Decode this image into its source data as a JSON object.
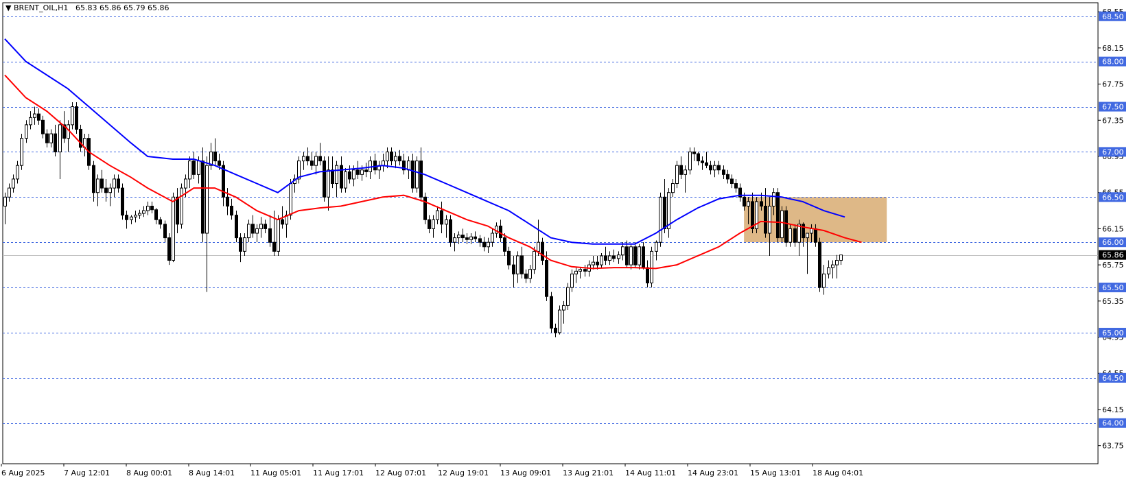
{
  "chart_data": {
    "type": "candlestick",
    "title": "BRENT_OIL,H1",
    "ohlc_header": "65.83 65.86 65.79 65.86",
    "current_price": 65.86,
    "ylim": [
      63.55,
      68.65
    ],
    "y_ticks": [
      "68.55",
      "68.15",
      "67.75",
      "67.35",
      "66.95",
      "66.55",
      "66.15",
      "65.75",
      "65.35",
      "64.95",
      "64.55",
      "64.15",
      "63.75"
    ],
    "levels": [
      "68.50",
      "68.00",
      "67.50",
      "67.00",
      "66.50",
      "66.00",
      "65.50",
      "65.00",
      "64.50",
      "64.00"
    ],
    "x_labels": [
      "6 Aug 2025",
      "7 Aug 12:01",
      "8 Aug 00:01",
      "8 Aug 14:01",
      "11 Aug 05:01",
      "11 Aug 17:01",
      "12 Aug 07:01",
      "12 Aug 19:01",
      "13 Aug 09:01",
      "13 Aug 21:01",
      "14 Aug 11:01",
      "14 Aug 23:01",
      "15 Aug 13:01",
      "18 Aug 04:01"
    ],
    "zone": {
      "from_bar": 176,
      "to_bar": 210,
      "low": 66.0,
      "high": 66.5,
      "color": "#deb887"
    },
    "colors": {
      "grid": "#4169e1",
      "ma_fast": "#ff0000",
      "ma_slow": "#0000ff",
      "zone": "#deb887"
    },
    "candles": [
      [
        66.4,
        66.55,
        66.2,
        66.5
      ],
      [
        66.5,
        66.65,
        66.45,
        66.6
      ],
      [
        66.6,
        66.75,
        66.55,
        66.7
      ],
      [
        66.7,
        66.9,
        66.65,
        66.85
      ],
      [
        66.85,
        67.2,
        66.8,
        67.15
      ],
      [
        67.15,
        67.35,
        67.1,
        67.3
      ],
      [
        67.3,
        67.45,
        67.25,
        67.38
      ],
      [
        67.38,
        67.5,
        67.3,
        67.42
      ],
      [
        67.42,
        67.48,
        67.3,
        67.35
      ],
      [
        67.35,
        67.4,
        67.15,
        67.2
      ],
      [
        67.2,
        67.25,
        67.05,
        67.1
      ],
      [
        67.1,
        67.25,
        67.05,
        67.2
      ],
      [
        67.2,
        67.3,
        66.95,
        67.0
      ],
      [
        67.0,
        67.35,
        66.7,
        67.3
      ],
      [
        67.3,
        67.45,
        67.1,
        67.15
      ],
      [
        67.15,
        67.35,
        67.0,
        67.3
      ],
      [
        67.3,
        67.55,
        67.25,
        67.5
      ],
      [
        67.5,
        67.55,
        67.2,
        67.25
      ],
      [
        67.25,
        67.3,
        67.0,
        67.05
      ],
      [
        67.05,
        67.2,
        66.95,
        67.15
      ],
      [
        67.15,
        67.2,
        66.8,
        66.85
      ],
      [
        66.85,
        66.9,
        66.45,
        66.55
      ],
      [
        66.55,
        66.75,
        66.4,
        66.7
      ],
      [
        66.7,
        66.8,
        66.55,
        66.6
      ],
      [
        66.6,
        66.7,
        66.45,
        66.55
      ],
      [
        66.55,
        66.65,
        66.4,
        66.6
      ],
      [
        66.6,
        66.75,
        66.5,
        66.7
      ],
      [
        66.7,
        66.75,
        66.55,
        66.6
      ],
      [
        66.6,
        66.65,
        66.25,
        66.3
      ],
      [
        66.3,
        66.35,
        66.15,
        66.25
      ],
      [
        66.25,
        66.3,
        66.2,
        66.28
      ],
      [
        66.28,
        66.35,
        66.22,
        66.3
      ],
      [
        66.3,
        66.36,
        66.26,
        66.32
      ],
      [
        66.32,
        66.4,
        66.28,
        66.35
      ],
      [
        66.35,
        66.45,
        66.3,
        66.4
      ],
      [
        66.4,
        66.45,
        66.32,
        66.36
      ],
      [
        66.36,
        66.38,
        66.2,
        66.25
      ],
      [
        66.25,
        66.28,
        66.15,
        66.2
      ],
      [
        66.2,
        66.24,
        66.0,
        66.05
      ],
      [
        66.05,
        66.1,
        65.75,
        65.8
      ],
      [
        65.8,
        66.55,
        65.78,
        66.5
      ],
      [
        66.5,
        66.6,
        66.1,
        66.2
      ],
      [
        66.2,
        66.65,
        66.15,
        66.6
      ],
      [
        66.6,
        66.75,
        66.5,
        66.7
      ],
      [
        66.7,
        66.95,
        66.6,
        66.9
      ],
      [
        66.9,
        67.0,
        66.7,
        66.75
      ],
      [
        66.75,
        66.95,
        66.65,
        66.9
      ],
      [
        66.9,
        67.05,
        66.0,
        66.1
      ],
      [
        66.1,
        66.95,
        65.45,
        66.85
      ],
      [
        66.85,
        67.1,
        66.8,
        67.0
      ],
      [
        67.0,
        67.15,
        66.85,
        66.9
      ],
      [
        66.9,
        66.98,
        66.8,
        66.85
      ],
      [
        66.85,
        66.9,
        66.4,
        66.5
      ],
      [
        66.5,
        66.6,
        66.3,
        66.4
      ],
      [
        66.4,
        66.48,
        66.25,
        66.3
      ],
      [
        66.3,
        66.35,
        66.0,
        66.05
      ],
      [
        66.05,
        66.1,
        65.78,
        65.9
      ],
      [
        65.9,
        66.1,
        65.85,
        66.05
      ],
      [
        66.05,
        66.25,
        66.0,
        66.2
      ],
      [
        66.2,
        66.3,
        66.05,
        66.1
      ],
      [
        66.1,
        66.2,
        66.0,
        66.15
      ],
      [
        66.15,
        66.28,
        66.05,
        66.2
      ],
      [
        66.2,
        66.25,
        66.1,
        66.15
      ],
      [
        66.15,
        66.3,
        65.95,
        66.0
      ],
      [
        66.0,
        66.35,
        65.85,
        65.9
      ],
      [
        65.9,
        66.3,
        65.85,
        66.25
      ],
      [
        66.25,
        66.4,
        66.15,
        66.2
      ],
      [
        66.2,
        66.35,
        66.05,
        66.3
      ],
      [
        66.3,
        66.7,
        66.25,
        66.65
      ],
      [
        66.65,
        66.75,
        66.55,
        66.7
      ],
      [
        66.7,
        66.95,
        66.65,
        66.9
      ],
      [
        66.9,
        67.0,
        66.8,
        66.95
      ],
      [
        66.95,
        67.05,
        66.85,
        66.9
      ],
      [
        66.9,
        67.0,
        66.8,
        66.85
      ],
      [
        66.85,
        67.0,
        66.75,
        66.95
      ],
      [
        66.95,
        67.1,
        66.85,
        66.9
      ],
      [
        66.9,
        66.95,
        66.45,
        66.5
      ],
      [
        66.5,
        66.95,
        66.35,
        66.8
      ],
      [
        66.8,
        66.95,
        66.6,
        66.65
      ],
      [
        66.65,
        66.9,
        66.5,
        66.85
      ],
      [
        66.85,
        66.95,
        66.55,
        66.6
      ],
      [
        66.6,
        66.82,
        66.55,
        66.78
      ],
      [
        66.78,
        66.85,
        66.65,
        66.7
      ],
      [
        66.7,
        66.85,
        66.62,
        66.8
      ],
      [
        66.8,
        66.9,
        66.7,
        66.75
      ],
      [
        66.75,
        66.85,
        66.68,
        66.8
      ],
      [
        66.8,
        66.88,
        66.72,
        66.78
      ],
      [
        66.78,
        66.95,
        66.7,
        66.9
      ],
      [
        66.9,
        66.98,
        66.75,
        66.8
      ],
      [
        66.8,
        66.9,
        66.7,
        66.85
      ],
      [
        66.85,
        66.98,
        66.78,
        66.9
      ],
      [
        66.9,
        67.05,
        66.82,
        67.0
      ],
      [
        67.0,
        67.05,
        66.85,
        66.9
      ],
      [
        66.9,
        67.0,
        66.82,
        66.95
      ],
      [
        66.95,
        67.02,
        66.85,
        66.9
      ],
      [
        66.9,
        66.98,
        66.75,
        66.8
      ],
      [
        66.8,
        66.95,
        66.7,
        66.9
      ],
      [
        66.9,
        66.98,
        66.55,
        66.6
      ],
      [
        66.6,
        66.95,
        66.55,
        66.9
      ],
      [
        66.9,
        67.05,
        66.45,
        66.5
      ],
      [
        66.5,
        66.55,
        66.2,
        66.25
      ],
      [
        66.25,
        66.3,
        66.1,
        66.15
      ],
      [
        66.15,
        66.3,
        66.05,
        66.25
      ],
      [
        66.25,
        66.4,
        66.2,
        66.35
      ],
      [
        66.35,
        66.45,
        66.1,
        66.2
      ],
      [
        66.2,
        66.3,
        66.05,
        66.25
      ],
      [
        66.25,
        66.3,
        65.95,
        66.0
      ],
      [
        66.0,
        66.1,
        65.9,
        66.05
      ],
      [
        66.05,
        66.12,
        65.98,
        66.08
      ],
      [
        66.08,
        66.15,
        66.0,
        66.05
      ],
      [
        66.05,
        66.1,
        65.98,
        66.03
      ],
      [
        66.03,
        66.1,
        65.98,
        66.06
      ],
      [
        66.06,
        66.12,
        66.0,
        66.04
      ],
      [
        66.04,
        66.08,
        65.95,
        66.0
      ],
      [
        66.0,
        66.06,
        65.9,
        65.95
      ],
      [
        65.95,
        66.05,
        65.88,
        66.0
      ],
      [
        66.0,
        66.15,
        65.95,
        66.1
      ],
      [
        66.1,
        66.22,
        66.05,
        66.18
      ],
      [
        66.18,
        66.25,
        66.0,
        66.05
      ],
      [
        66.05,
        66.1,
        65.85,
        65.9
      ],
      [
        65.9,
        65.95,
        65.7,
        65.75
      ],
      [
        65.75,
        65.85,
        65.5,
        65.65
      ],
      [
        65.65,
        65.9,
        65.55,
        65.85
      ],
      [
        65.85,
        65.95,
        65.6,
        65.65
      ],
      [
        65.65,
        65.7,
        65.55,
        65.6
      ],
      [
        65.6,
        65.75,
        65.55,
        65.7
      ],
      [
        65.7,
        65.95,
        65.65,
        65.9
      ],
      [
        65.9,
        66.25,
        65.85,
        66.0
      ],
      [
        66.0,
        66.05,
        65.75,
        65.8
      ],
      [
        65.8,
        65.9,
        65.35,
        65.4
      ],
      [
        65.4,
        65.45,
        65.0,
        65.05
      ],
      [
        65.05,
        65.1,
        64.95,
        65.0
      ],
      [
        65.0,
        65.3,
        64.98,
        65.25
      ],
      [
        65.25,
        65.35,
        65.1,
        65.3
      ],
      [
        65.3,
        65.55,
        65.25,
        65.5
      ],
      [
        65.5,
        65.7,
        65.45,
        65.65
      ],
      [
        65.65,
        65.72,
        65.55,
        65.68
      ],
      [
        65.68,
        65.72,
        65.6,
        65.7
      ],
      [
        65.7,
        65.75,
        65.62,
        65.68
      ],
      [
        65.68,
        65.8,
        65.62,
        65.75
      ],
      [
        65.75,
        65.85,
        65.7,
        65.78
      ],
      [
        65.78,
        65.85,
        65.7,
        65.75
      ],
      [
        65.75,
        65.88,
        65.72,
        65.85
      ],
      [
        65.85,
        65.95,
        65.75,
        65.8
      ],
      [
        65.8,
        65.9,
        65.75,
        65.85
      ],
      [
        65.85,
        65.92,
        65.78,
        65.82
      ],
      [
        65.82,
        65.9,
        65.76,
        65.86
      ],
      [
        65.86,
        66.0,
        65.8,
        65.95
      ],
      [
        65.95,
        66.02,
        65.72,
        65.75
      ],
      [
        65.75,
        65.98,
        65.7,
        65.95
      ],
      [
        65.95,
        66.0,
        65.72,
        65.75
      ],
      [
        65.75,
        65.98,
        65.7,
        65.95
      ],
      [
        65.95,
        66.0,
        65.7,
        65.72
      ],
      [
        65.72,
        65.8,
        65.5,
        65.55
      ],
      [
        65.55,
        65.95,
        65.5,
        65.9
      ],
      [
        65.9,
        66.02,
        65.8,
        66.0
      ],
      [
        66.0,
        66.55,
        65.95,
        66.5
      ],
      [
        66.5,
        66.7,
        66.1,
        66.15
      ],
      [
        66.15,
        66.6,
        66.05,
        66.55
      ],
      [
        66.55,
        66.7,
        66.5,
        66.65
      ],
      [
        66.65,
        66.9,
        66.6,
        66.85
      ],
      [
        66.85,
        66.95,
        66.7,
        66.75
      ],
      [
        66.75,
        66.85,
        66.55,
        66.8
      ],
      [
        66.8,
        67.05,
        66.75,
        67.0
      ],
      [
        67.0,
        67.05,
        66.9,
        66.98
      ],
      [
        66.98,
        67.0,
        66.85,
        66.9
      ],
      [
        66.9,
        66.95,
        66.8,
        66.88
      ],
      [
        66.88,
        67.0,
        66.82,
        66.85
      ],
      [
        66.85,
        66.9,
        66.75,
        66.8
      ],
      [
        66.8,
        66.9,
        66.72,
        66.85
      ],
      [
        66.85,
        66.9,
        66.75,
        66.8
      ],
      [
        66.8,
        66.85,
        66.7,
        66.75
      ],
      [
        66.75,
        66.8,
        66.65,
        66.7
      ],
      [
        66.7,
        66.75,
        66.6,
        66.65
      ],
      [
        66.65,
        66.7,
        66.55,
        66.6
      ],
      [
        66.6,
        66.65,
        66.45,
        66.5
      ],
      [
        66.5,
        66.55,
        66.35,
        66.4
      ],
      [
        66.4,
        66.5,
        66.2,
        66.45
      ],
      [
        66.45,
        66.55,
        66.1,
        66.15
      ],
      [
        66.15,
        66.5,
        66.1,
        66.45
      ],
      [
        66.45,
        66.55,
        66.35,
        66.4
      ],
      [
        66.4,
        66.6,
        66.05,
        66.1
      ],
      [
        66.1,
        66.5,
        65.85,
        66.4
      ],
      [
        66.4,
        66.6,
        66.3,
        66.55
      ],
      [
        66.55,
        66.6,
        66.0,
        66.05
      ],
      [
        66.05,
        66.4,
        66.0,
        66.35
      ],
      [
        66.35,
        66.4,
        65.95,
        66.0
      ],
      [
        66.0,
        66.2,
        65.95,
        66.15
      ],
      [
        66.15,
        66.2,
        65.95,
        66.0
      ],
      [
        66.0,
        66.25,
        65.85,
        66.2
      ],
      [
        66.2,
        66.22,
        65.95,
        66.05
      ],
      [
        66.05,
        66.1,
        65.65,
        66.1
      ],
      [
        66.1,
        66.2,
        66.0,
        66.15
      ],
      [
        66.15,
        66.2,
        65.95,
        66.0
      ],
      [
        66.0,
        66.05,
        65.45,
        65.5
      ],
      [
        65.5,
        65.75,
        65.42,
        65.65
      ],
      [
        65.65,
        65.8,
        65.6,
        65.72
      ],
      [
        65.72,
        65.8,
        65.6,
        65.75
      ],
      [
        65.75,
        65.86,
        65.6,
        65.8
      ],
      [
        65.8,
        65.86,
        65.75,
        65.86
      ]
    ],
    "ma_fast": [
      [
        0,
        67.85
      ],
      [
        5,
        67.6
      ],
      [
        10,
        67.45
      ],
      [
        15,
        67.25
      ],
      [
        20,
        67.0
      ],
      [
        25,
        66.85
      ],
      [
        30,
        66.72
      ],
      [
        34,
        66.6
      ],
      [
        40,
        66.45
      ],
      [
        45,
        66.6
      ],
      [
        50,
        66.6
      ],
      [
        55,
        66.5
      ],
      [
        60,
        66.35
      ],
      [
        65,
        66.25
      ],
      [
        70,
        66.35
      ],
      [
        75,
        66.38
      ],
      [
        80,
        66.4
      ],
      [
        85,
        66.45
      ],
      [
        90,
        66.5
      ],
      [
        95,
        66.52
      ],
      [
        100,
        66.45
      ],
      [
        105,
        66.35
      ],
      [
        110,
        66.25
      ],
      [
        115,
        66.18
      ],
      [
        120,
        66.05
      ],
      [
        125,
        65.95
      ],
      [
        130,
        65.8
      ],
      [
        135,
        65.73
      ],
      [
        140,
        65.71
      ],
      [
        145,
        65.72
      ],
      [
        150,
        65.72
      ],
      [
        155,
        65.71
      ],
      [
        160,
        65.75
      ],
      [
        165,
        65.85
      ],
      [
        170,
        65.95
      ],
      [
        175,
        66.1
      ],
      [
        180,
        66.23
      ],
      [
        185,
        66.22
      ],
      [
        190,
        66.17
      ],
      [
        195,
        66.13
      ],
      [
        200,
        66.05
      ],
      [
        204,
        66.0
      ]
    ],
    "ma_slow": [
      [
        0,
        68.25
      ],
      [
        5,
        68.0
      ],
      [
        10,
        67.85
      ],
      [
        15,
        67.7
      ],
      [
        20,
        67.5
      ],
      [
        25,
        67.3
      ],
      [
        30,
        67.1
      ],
      [
        34,
        66.95
      ],
      [
        40,
        66.92
      ],
      [
        45,
        66.92
      ],
      [
        50,
        66.85
      ],
      [
        55,
        66.75
      ],
      [
        60,
        66.65
      ],
      [
        65,
        66.55
      ],
      [
        70,
        66.72
      ],
      [
        75,
        66.78
      ],
      [
        80,
        66.8
      ],
      [
        85,
        66.82
      ],
      [
        90,
        66.85
      ],
      [
        95,
        66.82
      ],
      [
        100,
        66.75
      ],
      [
        105,
        66.65
      ],
      [
        110,
        66.55
      ],
      [
        115,
        66.45
      ],
      [
        120,
        66.35
      ],
      [
        125,
        66.2
      ],
      [
        130,
        66.05
      ],
      [
        135,
        66.0
      ],
      [
        140,
        65.98
      ],
      [
        145,
        65.98
      ],
      [
        150,
        65.98
      ],
      [
        155,
        66.1
      ],
      [
        160,
        66.25
      ],
      [
        165,
        66.38
      ],
      [
        170,
        66.48
      ],
      [
        175,
        66.52
      ],
      [
        180,
        66.52
      ],
      [
        185,
        66.5
      ],
      [
        190,
        66.45
      ],
      [
        195,
        66.35
      ],
      [
        200,
        66.28
      ]
    ]
  }
}
